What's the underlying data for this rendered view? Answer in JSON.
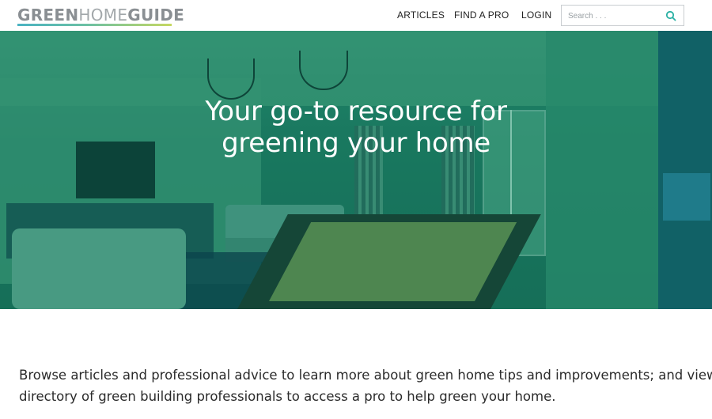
{
  "header": {
    "logo": {
      "part1": "GREEN",
      "part2": "HOME",
      "part3": "GUIDE"
    },
    "nav": {
      "articles": "ARTICLES",
      "find_a_pro": "FIND A PRO",
      "login": "LOGIN"
    },
    "search": {
      "placeholder": "Search . . .",
      "value": ""
    }
  },
  "hero": {
    "title_line1": "Your go-to resource for",
    "title_line2": "greening your home"
  },
  "intro": {
    "line1": "Browse articles and professional advice to learn more about green home tips and improvements; and view our",
    "line2": "directory of green building professionals to access a pro to help green your home."
  },
  "colors": {
    "accent_teal": "#2ab0a4",
    "hero_tint": "#1f7a61"
  }
}
